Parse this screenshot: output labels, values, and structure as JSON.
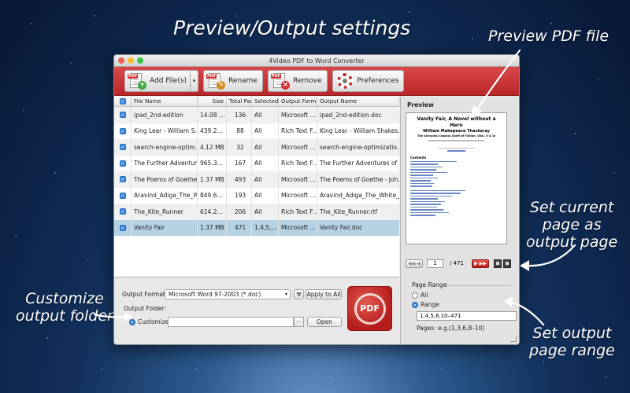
{
  "annotations": {
    "top_title": "Preview/Output settings",
    "preview_pdf": "Preview PDF file",
    "set_current_page": [
      "Set current",
      "page as",
      "output page"
    ],
    "customize_folder": [
      "Customize",
      "output folder"
    ],
    "set_range": [
      "Set output",
      "page range"
    ]
  },
  "window": {
    "title": "4Video PDF to Word Converter"
  },
  "toolbar": {
    "add_files": "Add File(s)",
    "rename": "Rename",
    "remove": "Remove",
    "preferences": "Preferences",
    "pdf_tag": "PDF"
  },
  "table": {
    "headers": [
      "File Name",
      "Size",
      "Total Pag",
      "Selected",
      "Output Forma",
      "Output Name"
    ],
    "rows": [
      {
        "name": "ipad_2nd-edition",
        "size": "14.08 …",
        "pages": "136",
        "selected": "All",
        "format": "Microsoft …",
        "output": "ipad_2nd-edition.doc"
      },
      {
        "name": "King Lear - William S…",
        "size": "439.2…",
        "pages": "88",
        "selected": "All",
        "format": "Rich Text F…",
        "output": "King Lear - William Shakes…"
      },
      {
        "name": "search-engine-optim…",
        "size": "4.12 MB",
        "pages": "32",
        "selected": "All",
        "format": "Microsoft …",
        "output": "search-engine-optimizatio…"
      },
      {
        "name": "The Further Adventur…",
        "size": "965.3…",
        "pages": "167",
        "selected": "All",
        "format": "Rich Text F…",
        "output": "The Further Adventures of …"
      },
      {
        "name": "The Poems of Goethe …",
        "size": "1.37 MB",
        "pages": "493",
        "selected": "All",
        "format": "Microsoft …",
        "output": "The Poems of Goethe - Joh…"
      },
      {
        "name": "Aravind_Adiga_The_W…",
        "size": "849.6…",
        "pages": "193",
        "selected": "All",
        "format": "Microsoft …",
        "output": "Aravind_Adiga_The_White_…"
      },
      {
        "name": "The_Kite_Runner",
        "size": "614.2…",
        "pages": "206",
        "selected": "All",
        "format": "Rich Text F…",
        "output": "The_Kite_Runner.rtf"
      },
      {
        "name": "Vanity Fair",
        "size": "1.37 MB",
        "pages": "471",
        "selected": "1,4,5,…",
        "format": "Microsoft …",
        "output": "Vanity Fair.doc"
      }
    ]
  },
  "settings": {
    "output_format_label": "Output Format:",
    "output_format_value": "Microsoft Word 97-2003 (*.doc)",
    "apply_to_all": "Apply to All",
    "output_folder_label": "Output Folder:",
    "customize_label": "Customize:",
    "browse": "···",
    "open": "Open",
    "convert_label": "PDF"
  },
  "preview": {
    "label": "Preview",
    "doc_title": "Vanity Fair, A Novel without a Hero",
    "doc_author": "William Makepeace Thackeray",
    "doc_sub": "The Servants Classics Shelf of Fiction, Vols. V & VI",
    "doc_contents": "Contents",
    "current_page": "1",
    "total_pages": "/ 471"
  },
  "page_range": {
    "title": "Page Range",
    "all": "All",
    "range": "Range",
    "range_value": "1,4,5,8,10–471",
    "hint": "Pages: e.g.(1,3,6,8–10)"
  },
  "colors": {
    "toolbar_red": "#c8393a",
    "selected_row": "#b4d2e4",
    "checkbox_blue": "#3c8ce0"
  }
}
